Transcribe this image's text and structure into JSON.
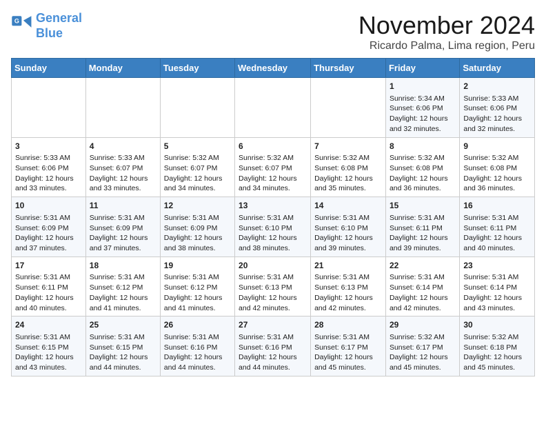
{
  "header": {
    "logo_line1": "General",
    "logo_line2": "Blue",
    "month_title": "November 2024",
    "location": "Ricardo Palma, Lima region, Peru"
  },
  "calendar": {
    "days_of_week": [
      "Sunday",
      "Monday",
      "Tuesday",
      "Wednesday",
      "Thursday",
      "Friday",
      "Saturday"
    ],
    "weeks": [
      [
        {
          "day": "",
          "data": ""
        },
        {
          "day": "",
          "data": ""
        },
        {
          "day": "",
          "data": ""
        },
        {
          "day": "",
          "data": ""
        },
        {
          "day": "",
          "data": ""
        },
        {
          "day": "1",
          "data": "Sunrise: 5:34 AM\nSunset: 6:06 PM\nDaylight: 12 hours and 32 minutes."
        },
        {
          "day": "2",
          "data": "Sunrise: 5:33 AM\nSunset: 6:06 PM\nDaylight: 12 hours and 32 minutes."
        }
      ],
      [
        {
          "day": "3",
          "data": "Sunrise: 5:33 AM\nSunset: 6:06 PM\nDaylight: 12 hours and 33 minutes."
        },
        {
          "day": "4",
          "data": "Sunrise: 5:33 AM\nSunset: 6:07 PM\nDaylight: 12 hours and 33 minutes."
        },
        {
          "day": "5",
          "data": "Sunrise: 5:32 AM\nSunset: 6:07 PM\nDaylight: 12 hours and 34 minutes."
        },
        {
          "day": "6",
          "data": "Sunrise: 5:32 AM\nSunset: 6:07 PM\nDaylight: 12 hours and 34 minutes."
        },
        {
          "day": "7",
          "data": "Sunrise: 5:32 AM\nSunset: 6:08 PM\nDaylight: 12 hours and 35 minutes."
        },
        {
          "day": "8",
          "data": "Sunrise: 5:32 AM\nSunset: 6:08 PM\nDaylight: 12 hours and 36 minutes."
        },
        {
          "day": "9",
          "data": "Sunrise: 5:32 AM\nSunset: 6:08 PM\nDaylight: 12 hours and 36 minutes."
        }
      ],
      [
        {
          "day": "10",
          "data": "Sunrise: 5:31 AM\nSunset: 6:09 PM\nDaylight: 12 hours and 37 minutes."
        },
        {
          "day": "11",
          "data": "Sunrise: 5:31 AM\nSunset: 6:09 PM\nDaylight: 12 hours and 37 minutes."
        },
        {
          "day": "12",
          "data": "Sunrise: 5:31 AM\nSunset: 6:09 PM\nDaylight: 12 hours and 38 minutes."
        },
        {
          "day": "13",
          "data": "Sunrise: 5:31 AM\nSunset: 6:10 PM\nDaylight: 12 hours and 38 minutes."
        },
        {
          "day": "14",
          "data": "Sunrise: 5:31 AM\nSunset: 6:10 PM\nDaylight: 12 hours and 39 minutes."
        },
        {
          "day": "15",
          "data": "Sunrise: 5:31 AM\nSunset: 6:11 PM\nDaylight: 12 hours and 39 minutes."
        },
        {
          "day": "16",
          "data": "Sunrise: 5:31 AM\nSunset: 6:11 PM\nDaylight: 12 hours and 40 minutes."
        }
      ],
      [
        {
          "day": "17",
          "data": "Sunrise: 5:31 AM\nSunset: 6:11 PM\nDaylight: 12 hours and 40 minutes."
        },
        {
          "day": "18",
          "data": "Sunrise: 5:31 AM\nSunset: 6:12 PM\nDaylight: 12 hours and 41 minutes."
        },
        {
          "day": "19",
          "data": "Sunrise: 5:31 AM\nSunset: 6:12 PM\nDaylight: 12 hours and 41 minutes."
        },
        {
          "day": "20",
          "data": "Sunrise: 5:31 AM\nSunset: 6:13 PM\nDaylight: 12 hours and 42 minutes."
        },
        {
          "day": "21",
          "data": "Sunrise: 5:31 AM\nSunset: 6:13 PM\nDaylight: 12 hours and 42 minutes."
        },
        {
          "day": "22",
          "data": "Sunrise: 5:31 AM\nSunset: 6:14 PM\nDaylight: 12 hours and 42 minutes."
        },
        {
          "day": "23",
          "data": "Sunrise: 5:31 AM\nSunset: 6:14 PM\nDaylight: 12 hours and 43 minutes."
        }
      ],
      [
        {
          "day": "24",
          "data": "Sunrise: 5:31 AM\nSunset: 6:15 PM\nDaylight: 12 hours and 43 minutes."
        },
        {
          "day": "25",
          "data": "Sunrise: 5:31 AM\nSunset: 6:15 PM\nDaylight: 12 hours and 44 minutes."
        },
        {
          "day": "26",
          "data": "Sunrise: 5:31 AM\nSunset: 6:16 PM\nDaylight: 12 hours and 44 minutes."
        },
        {
          "day": "27",
          "data": "Sunrise: 5:31 AM\nSunset: 6:16 PM\nDaylight: 12 hours and 44 minutes."
        },
        {
          "day": "28",
          "data": "Sunrise: 5:31 AM\nSunset: 6:17 PM\nDaylight: 12 hours and 45 minutes."
        },
        {
          "day": "29",
          "data": "Sunrise: 5:32 AM\nSunset: 6:17 PM\nDaylight: 12 hours and 45 minutes."
        },
        {
          "day": "30",
          "data": "Sunrise: 5:32 AM\nSunset: 6:18 PM\nDaylight: 12 hours and 45 minutes."
        }
      ]
    ]
  }
}
